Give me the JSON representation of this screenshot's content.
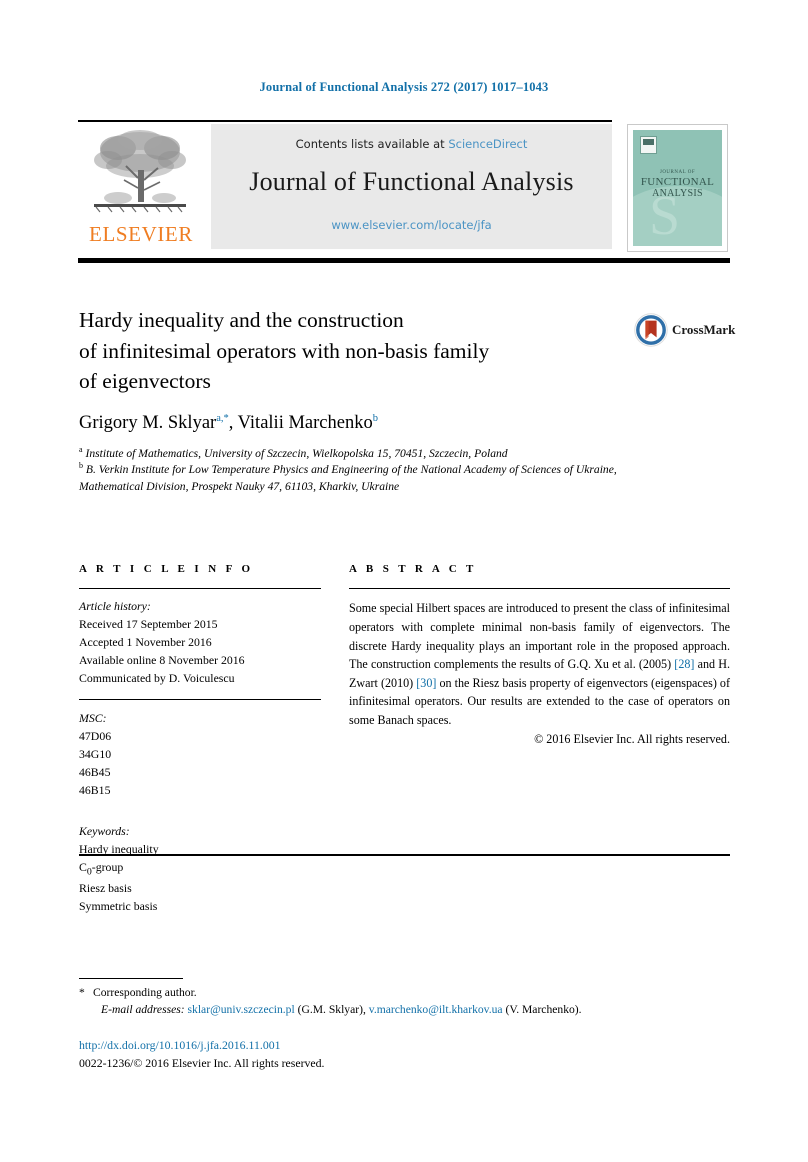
{
  "running_head": "Journal of Functional Analysis 272 (2017) 1017–1043",
  "masthead": {
    "contents_prefix": "Contents lists available at ",
    "sciencedirect": "ScienceDirect",
    "journal_name": "Journal of Functional Analysis",
    "journal_url": "www.elsevier.com/locate/jfa",
    "publisher": "ELSEVIER",
    "cover": {
      "line1": "JOURNAL OF",
      "line2": "FUNCTIONAL",
      "line3": "ANALYSIS",
      "swoosh_letter": "S"
    }
  },
  "article": {
    "title_line1": "Hardy inequality and the construction",
    "title_line2": "of infinitesimal operators with non-basis family",
    "title_line3": "of eigenvectors",
    "crossmark_label": "CrossMark",
    "authors": {
      "author1_name": "Grigory M. Sklyar",
      "author1_marks": "a,*",
      "separator": ", ",
      "author2_name": "Vitalii Marchenko",
      "author2_marks": "b"
    },
    "affiliations": [
      {
        "mark": "a",
        "text": "Institute of Mathematics, University of Szczecin, Wielkopolska 15, 70451, Szczecin, Poland"
      },
      {
        "mark": "b",
        "text": "B. Verkin Institute for Low Temperature Physics and Engineering of the National Academy of Sciences of Ukraine, Mathematical Division, Prospekt Nauky 47, 61103, Kharkiv, Ukraine"
      }
    ]
  },
  "info": {
    "heading": "A R T I C L E   I N F O",
    "history_label": "Article history:",
    "history": [
      "Received 17 September 2015",
      "Accepted 1 November 2016",
      "Available online 8 November 2016",
      "Communicated by D. Voiculescu"
    ],
    "msc_label": "MSC:",
    "msc": [
      "47D06",
      "34G10",
      "46B45",
      "46B15"
    ],
    "keywords_label": "Keywords:",
    "keywords": [
      "Hardy inequality",
      "C0-group",
      "Riesz basis",
      "Symmetric basis"
    ],
    "keyword_c0_base": "C",
    "keyword_c0_sub": "0",
    "keyword_c0_rest": "-group"
  },
  "abstract": {
    "heading": "A B S T R A C T",
    "text_part1": "Some special Hilbert spaces are introduced to present the class of infinitesimal operators with complete minimal non-basis family of eigenvectors. The discrete Hardy inequality plays an important role in the proposed approach. The construction complements the results of G.Q. Xu et al. (2005) ",
    "ref1": "[28]",
    "text_part2": " and H. Zwart (2010) ",
    "ref2": "[30]",
    "text_part3": " on the Riesz basis property of eigenvectors (eigenspaces) of infinitesimal operators. Our results are extended to the case of operators on some Banach spaces.",
    "copyright": "© 2016 Elsevier Inc. All rights reserved."
  },
  "footnotes": {
    "corresponding_marker": "*",
    "corresponding_text": "Corresponding author.",
    "email_label": "E-mail addresses:",
    "email1": "sklar@univ.szczecin.pl",
    "email1_owner": "(G.M. Sklyar),",
    "email2": "v.marchenko@ilt.kharkov.ua",
    "email2_owner": "(V. Marchenko)."
  },
  "footer": {
    "doi": "http://dx.doi.org/10.1016/j.jfa.2016.11.001",
    "issn_line": "0022-1236/© 2016 Elsevier Inc. All rights reserved."
  },
  "colors": {
    "link_blue": "#1270a8",
    "light_blue": "#4a93c4",
    "elsevier_orange": "#ef7d22",
    "cover_green": "#8fc2b5"
  }
}
